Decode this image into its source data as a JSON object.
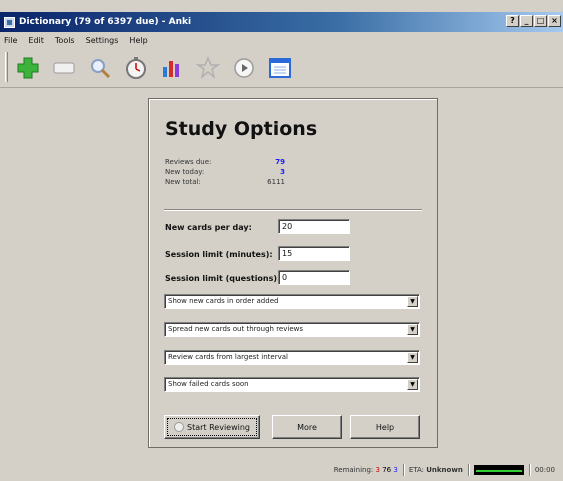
{
  "window": {
    "title": "Dictionary (79 of 6397 due) - Anki",
    "controls": [
      "?",
      "_",
      "□",
      "×"
    ]
  },
  "menu": [
    "File",
    "Edit",
    "Tools",
    "Settings",
    "Help"
  ],
  "toolbar": {
    "icons": [
      "add-icon",
      "cardlist-icon",
      "search-icon",
      "timer-icon",
      "graph-icon",
      "star-icon",
      "play-icon",
      "window-icon"
    ]
  },
  "study": {
    "heading": "Study Options",
    "stats": [
      {
        "label": "Reviews due:",
        "value": "79",
        "style": "blue"
      },
      {
        "label": "New today:",
        "value": "3",
        "style": "blue"
      },
      {
        "label": "New total:",
        "value": "6111",
        "style": "plain"
      }
    ],
    "fields": [
      {
        "label": "New cards per day:",
        "value": "20"
      },
      {
        "label": "Session limit (minutes):",
        "value": "15"
      },
      {
        "label": "Session limit (questions):",
        "value": "0"
      }
    ],
    "selects": [
      "Show new cards in order added",
      "Spread new cards out through reviews",
      "Review cards from largest interval",
      "Show failed cards soon"
    ],
    "buttons": {
      "start": "Start Reviewing",
      "more": "More",
      "help": "Help"
    }
  },
  "status": {
    "remaining_label": "Remaining:",
    "remaining_new": "3",
    "remaining_review": "76",
    "remaining_failed": "3",
    "eta_label": "ETA:",
    "eta_value": "Unknown",
    "time": "00:00"
  },
  "colors": {
    "title_bar": "#0a246a",
    "highlight_blue": "#1a1aff",
    "red": "#d00000",
    "progress_fill": "#33cc33"
  }
}
